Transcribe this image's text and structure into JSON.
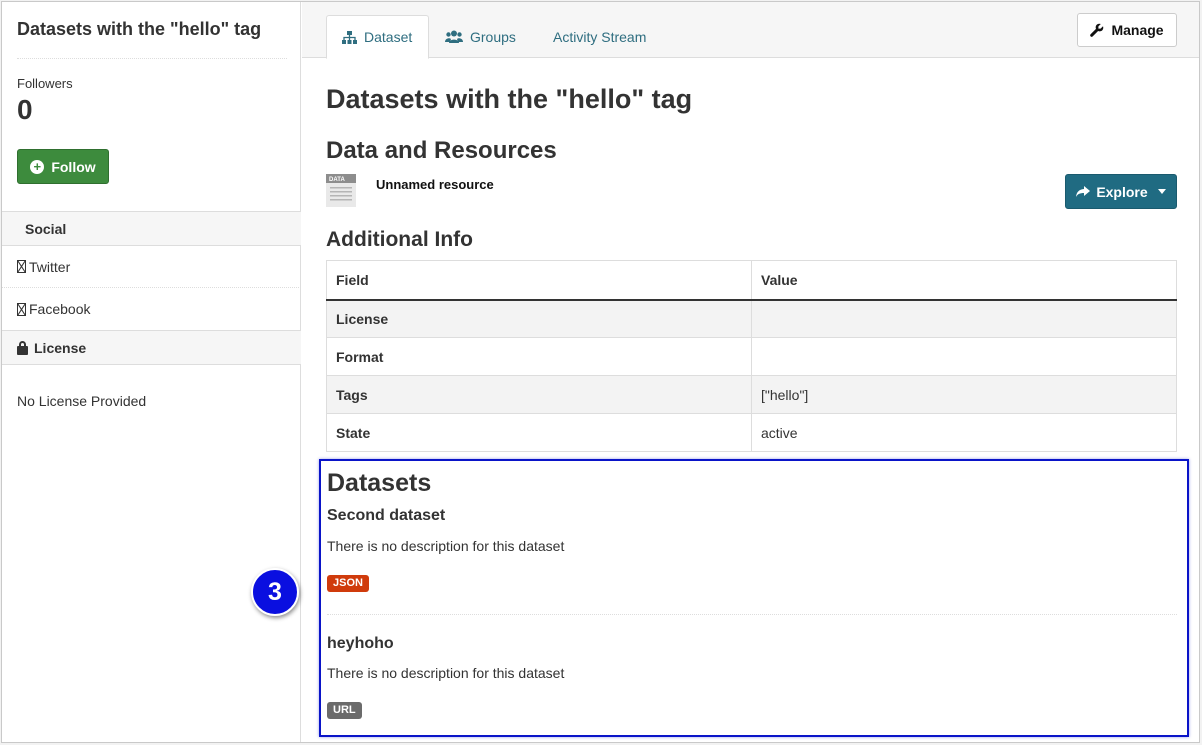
{
  "sidebar": {
    "title": "Datasets with the \"hello\" tag",
    "followers_label": "Followers",
    "followers_count": "0",
    "follow_label": "Follow",
    "social_heading": "Social",
    "social_links": [
      {
        "label": "Twitter",
        "icon": "missing-glyph-icon"
      },
      {
        "label": "Facebook",
        "icon": "missing-glyph-icon"
      }
    ],
    "license_heading": "License",
    "license_text": "No License Provided"
  },
  "tabs": [
    {
      "label": "Dataset",
      "icon": "sitemap-icon",
      "active": true
    },
    {
      "label": "Groups",
      "icon": "users-icon",
      "active": false
    },
    {
      "label": "Activity Stream",
      "active": false
    }
  ],
  "manage_label": "Manage",
  "page_title": "Datasets with the \"hello\" tag",
  "resources": {
    "heading": "Data and Resources",
    "items": [
      {
        "name": "Unnamed resource",
        "icon": "data-file-icon"
      }
    ],
    "explore_label": "Explore"
  },
  "additional_info": {
    "heading": "Additional Info",
    "columns": [
      "Field",
      "Value"
    ],
    "rows": [
      {
        "field": "License",
        "value": ""
      },
      {
        "field": "Format",
        "value": ""
      },
      {
        "field": "Tags",
        "value": "[\"hello\"]"
      },
      {
        "field": "State",
        "value": "active"
      }
    ]
  },
  "datasets": {
    "heading": "Datasets",
    "items": [
      {
        "title": "Second dataset",
        "description": "There is no description for this dataset",
        "format": "JSON"
      },
      {
        "title": "heyhoho",
        "description": "There is no description for this dataset",
        "format": "URL"
      }
    ]
  },
  "step_marker": "3",
  "colors": {
    "follow_green": "#3d8b3d",
    "explore_teal": "#206b82",
    "tab_link": "#2f6e80",
    "json_badge": "#d03b0c",
    "url_badge": "#6b6b6b",
    "highlight_blue": "#0a14c8"
  }
}
